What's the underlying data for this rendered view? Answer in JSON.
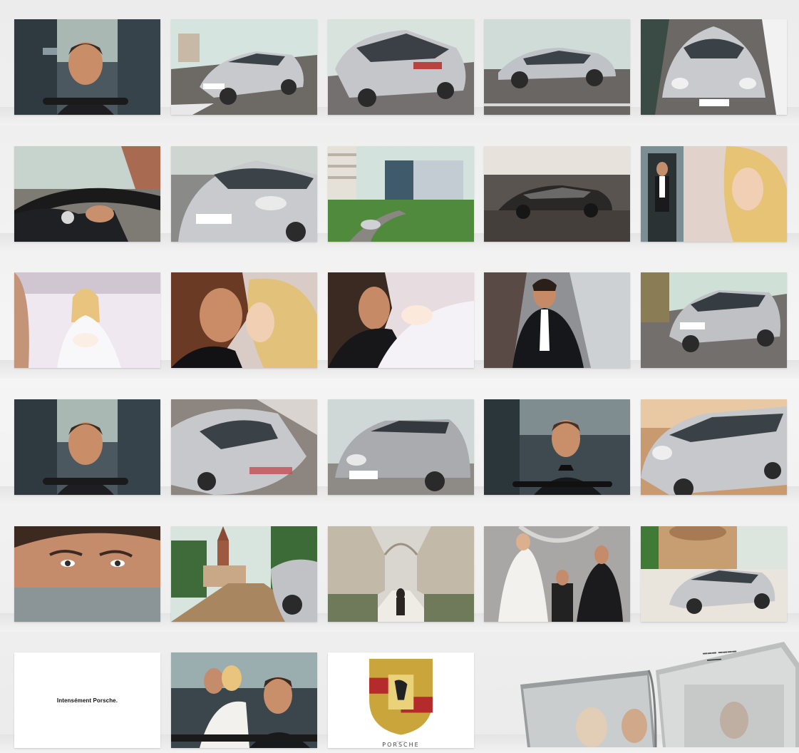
{
  "rows": [
    {
      "panels": [
        {
          "scene": "driver-close-up"
        },
        {
          "scene": "suv-front-three-quarter"
        },
        {
          "scene": "suv-rear-three-quarter"
        },
        {
          "scene": "car-side-profile"
        },
        {
          "scene": "car-front-on"
        }
      ]
    },
    {
      "panels": [
        {
          "scene": "hand-on-wheel-watch"
        },
        {
          "scene": "car-front-close"
        },
        {
          "scene": "building-and-car"
        },
        {
          "scene": "dark-car-side"
        },
        {
          "scene": "man-and-blonde-woman"
        }
      ]
    },
    {
      "panels": [
        {
          "scene": "woman-in-bed"
        },
        {
          "scene": "couple-kiss"
        },
        {
          "scene": "man-kiss-baby"
        },
        {
          "scene": "man-running"
        },
        {
          "scene": "suv-driving"
        }
      ]
    },
    {
      "panels": [
        {
          "scene": "driver-close-up"
        },
        {
          "scene": "car-overhead-speed"
        },
        {
          "scene": "suv-front"
        },
        {
          "scene": "driver-tuxedo"
        },
        {
          "scene": "car-front-side"
        }
      ]
    },
    {
      "panels": [
        {
          "scene": "eyes-rear-view-mirror"
        },
        {
          "scene": "church-road-car"
        },
        {
          "scene": "church-interior-aisle"
        },
        {
          "scene": "bride-and-priest"
        },
        {
          "scene": "car-by-church"
        }
      ]
    }
  ],
  "last_row": {
    "slogan": "Intensément Porsche.",
    "couple_scene": "couple-in-car",
    "brand": "PORSCHE",
    "fine_print": "porsche.fr"
  },
  "colors": {
    "background": "#efefef",
    "silver": "#c9ccd0",
    "road": "#6f6a66",
    "sky": "#cfe0dc"
  }
}
